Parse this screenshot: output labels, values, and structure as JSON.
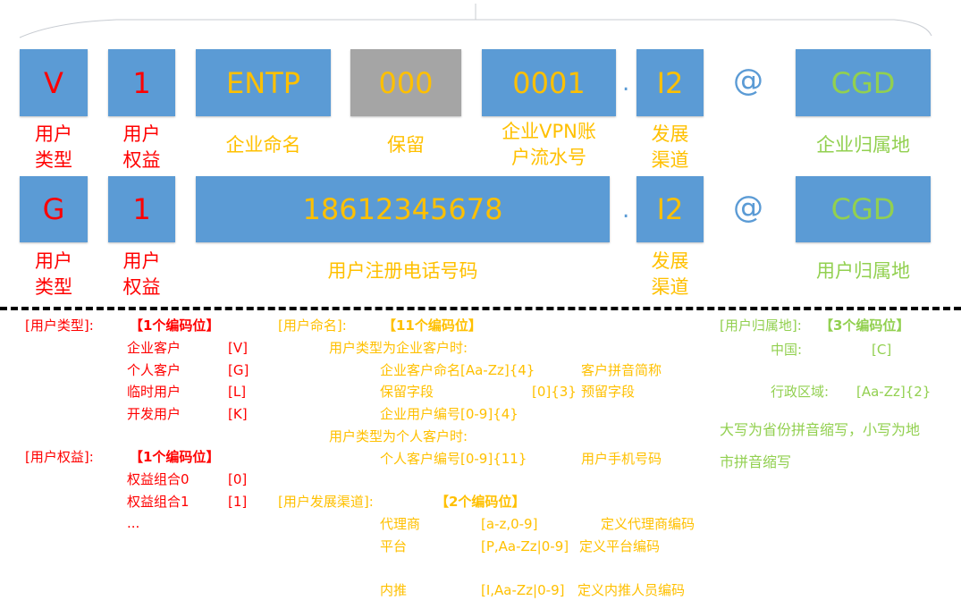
{
  "colors": {
    "box": "#5b9bd5",
    "reserved_box": "#a5a5a5",
    "red": "#ff0000",
    "orange": "#ffc000",
    "green": "#92d050"
  },
  "row1": {
    "type": "V",
    "rights": "1",
    "name": "ENTP",
    "reserved": "000",
    "serial": "0001",
    "dot": ".",
    "channel": "I2",
    "at": "@",
    "region": "CGD",
    "labels": {
      "type": "用户\n类型",
      "rights": "用户\n权益",
      "name": "企业命名",
      "reserved": "保留",
      "serial": "企业VPN账\n户流水号",
      "channel": "发展\n渠道",
      "region": "企业归属地"
    }
  },
  "row2": {
    "type": "G",
    "rights": "1",
    "phone": "18612345678",
    "dot": ".",
    "channel": "I2",
    "at": "@",
    "region": "CGD",
    "labels": {
      "type": "用户\n类型",
      "rights": "用户\n权益",
      "phone": "用户注册电话号码",
      "channel": "发展\n渠道",
      "region": "用户归属地"
    }
  },
  "legend_left": [
    "[用户类型]:",
    "【1个编码位】",
    "企业客户",
    "[V]",
    "个人客户",
    "[G]",
    "临时用户",
    "[L]",
    "开发用户",
    "[K]",
    "[用户权益]:",
    "【1个编码位】",
    "权益组合0",
    "[0]",
    "权益组合1",
    "[1]",
    "..."
  ],
  "legend_mid": [
    "[用户命名]:",
    "【11个编码位】",
    "用户类型为企业客户时:",
    "企业客户命名[Aa-Zz]{4}",
    "客户拼音简称",
    "保留字段",
    "[0]{3}",
    "预留字段",
    "企业用户编号[0-9]{4}",
    "用户类型为个人客户时:",
    "个人客户编号[0-9]{11}",
    "用户手机号码",
    "[用户发展渠道]:",
    "【2个编码位】",
    "代理商",
    "[a-z,0-9]",
    "定义代理商编码",
    "平台",
    "[P,Aa-Zz|0-9]",
    "定义平台编码",
    "内推",
    "[I,Aa-Zz|0-9]",
    "定义内推人员编码"
  ],
  "legend_right": [
    "[用户归属地]:",
    "【3个编码位】",
    "中国:",
    "[C]",
    "行政区域:",
    "[Aa-Zz]{2}",
    "大写为省份拼音缩写，小写为地",
    "市拼音缩写"
  ]
}
